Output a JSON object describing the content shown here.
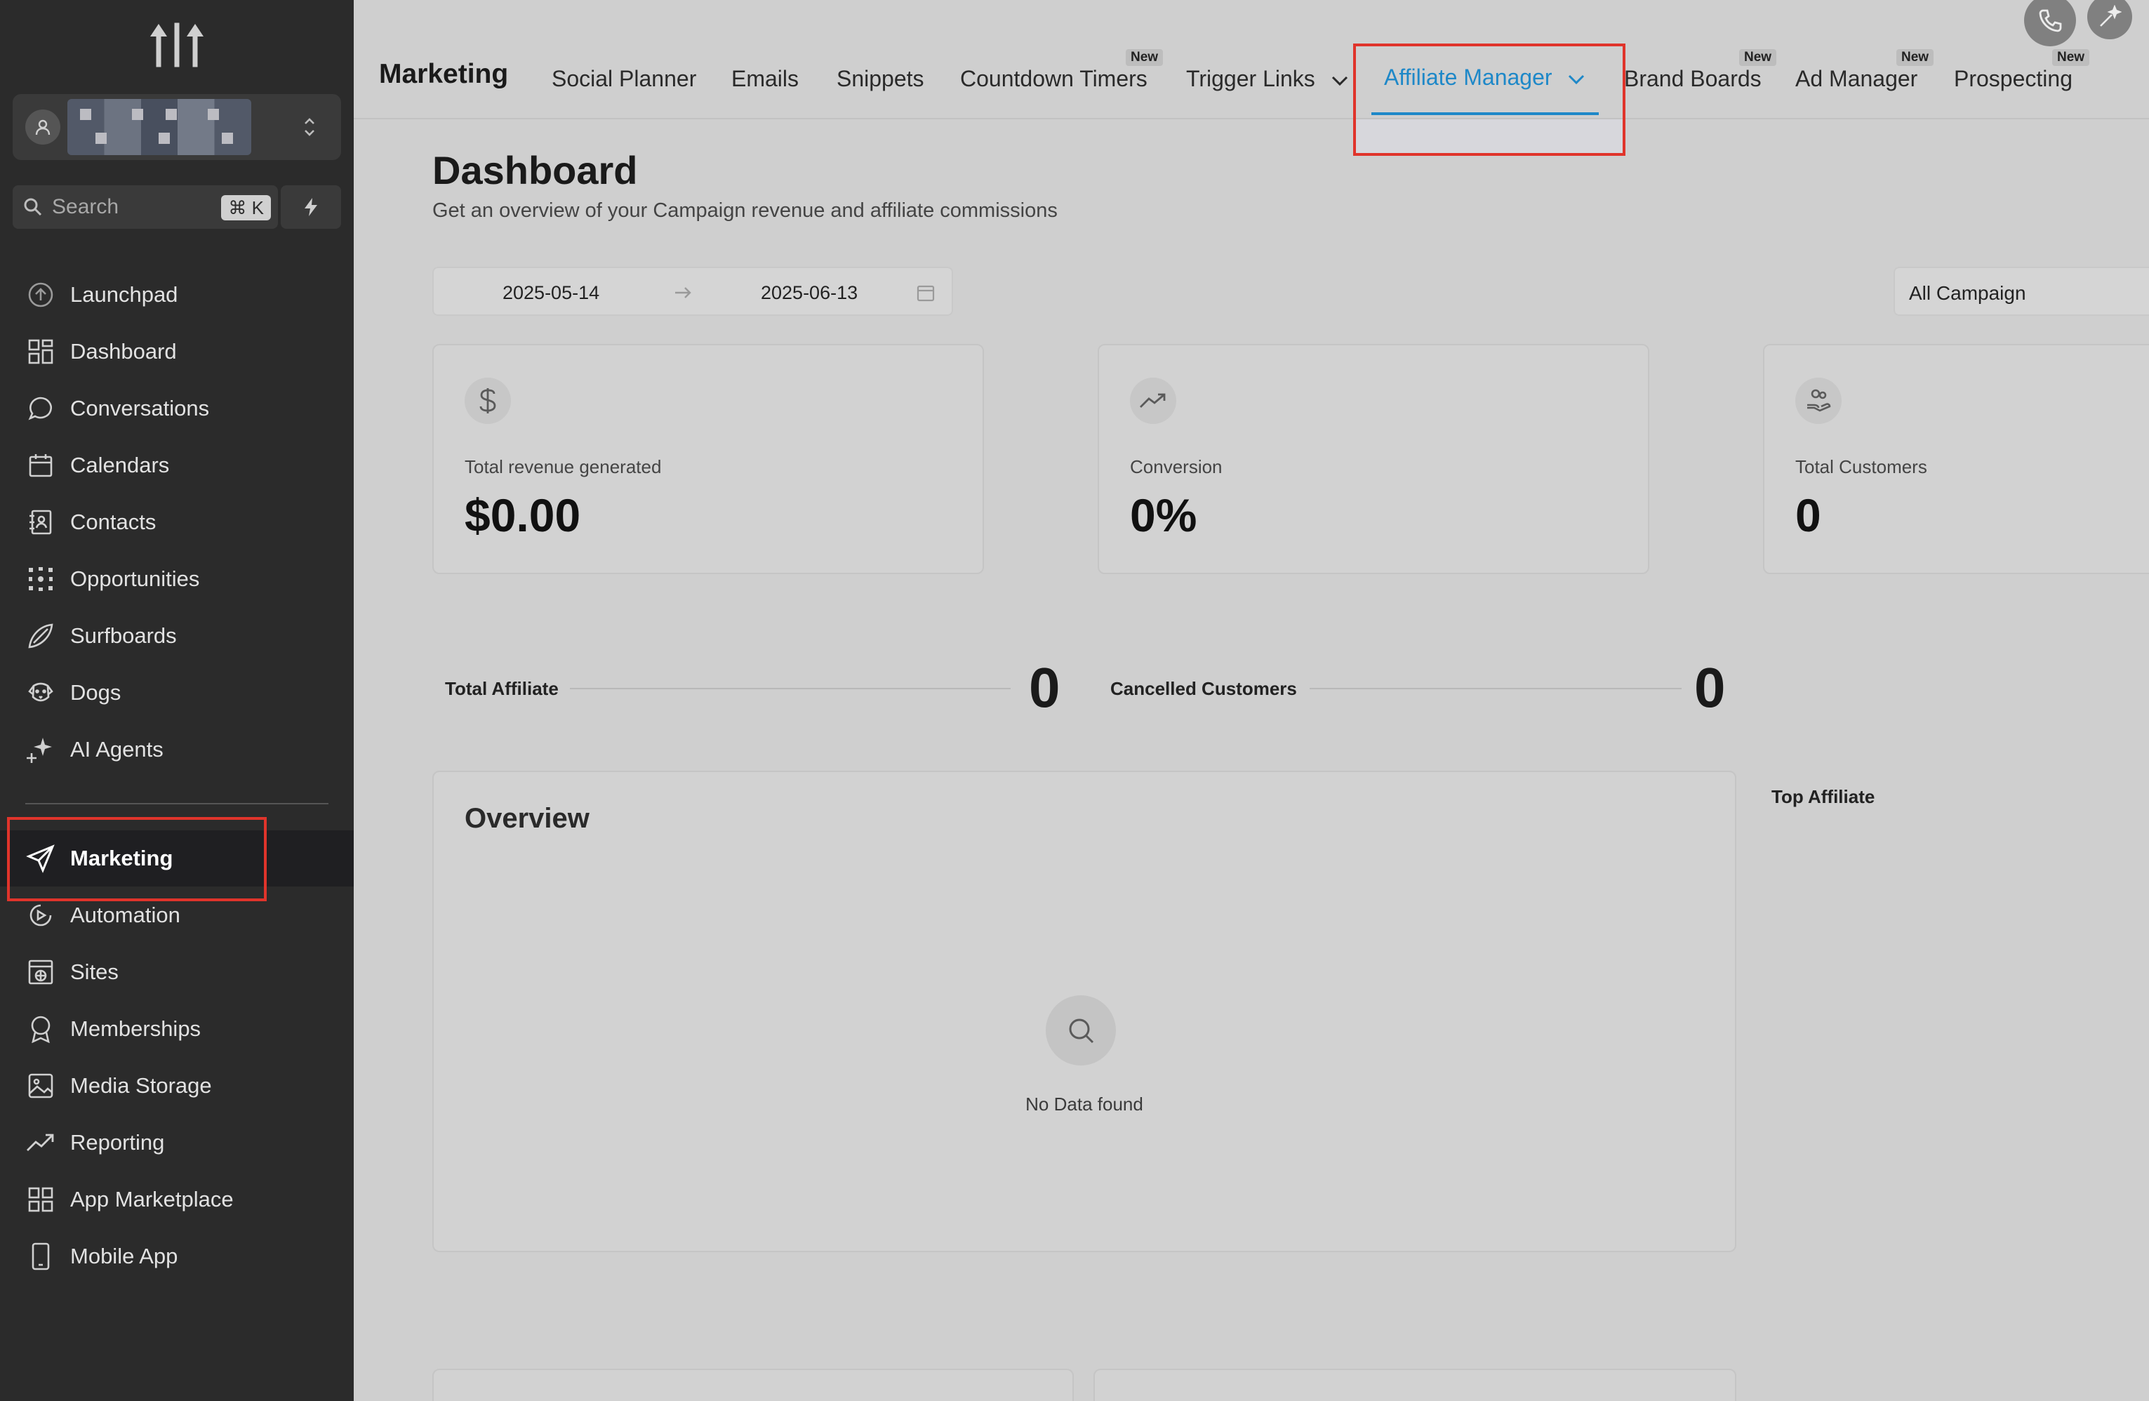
{
  "sidebar": {
    "search": {
      "placeholder": "Search",
      "shortcut": "⌘ K"
    },
    "items": [
      {
        "label": "Launchpad",
        "icon": "launchpad-icon"
      },
      {
        "label": "Dashboard",
        "icon": "grid-icon"
      },
      {
        "label": "Conversations",
        "icon": "chat-icon"
      },
      {
        "label": "Calendars",
        "icon": "calendar-icon"
      },
      {
        "label": "Contacts",
        "icon": "contacts-icon"
      },
      {
        "label": "Opportunities",
        "icon": "opportunities-icon"
      },
      {
        "label": "Surfboards",
        "icon": "surfboard-icon"
      },
      {
        "label": "Dogs",
        "icon": "dog-icon"
      },
      {
        "label": "AI Agents",
        "icon": "sparkle-icon"
      }
    ],
    "items_lower": [
      {
        "label": "Marketing",
        "icon": "send-icon",
        "active": true
      },
      {
        "label": "Automation",
        "icon": "automation-icon"
      },
      {
        "label": "Sites",
        "icon": "sites-icon"
      },
      {
        "label": "Memberships",
        "icon": "badge-icon"
      },
      {
        "label": "Media Storage",
        "icon": "image-icon"
      },
      {
        "label": "Reporting",
        "icon": "trend-icon"
      },
      {
        "label": "App Marketplace",
        "icon": "apps-icon"
      },
      {
        "label": "Mobile App",
        "icon": "phone-icon"
      }
    ]
  },
  "topbar": {
    "title": "Marketing",
    "tabs": [
      {
        "label": "Social Planner"
      },
      {
        "label": "Emails"
      },
      {
        "label": "Snippets"
      },
      {
        "label": "Countdown Timers",
        "badge": "New"
      },
      {
        "label": "Trigger Links"
      },
      {
        "label": "Affiliate Manager",
        "active": true
      },
      {
        "label": "Brand Boards",
        "badge": "New"
      },
      {
        "label": "Ad Manager",
        "badge": "New"
      },
      {
        "label": "Prospecting",
        "badge": "New"
      }
    ]
  },
  "page": {
    "title": "Dashboard",
    "subtitle": "Get an overview of your Campaign revenue and affiliate commissions",
    "date_start": "2025-05-14",
    "date_end": "2025-06-13",
    "campaign_filter": "All Campaign"
  },
  "stats": [
    {
      "label": "Total revenue generated",
      "value": "$0.00",
      "icon": "dollar-icon"
    },
    {
      "label": "Conversion",
      "value": "0%",
      "icon": "trend-up-icon"
    },
    {
      "label": "Total Customers",
      "value": "0",
      "icon": "customers-icon"
    }
  ],
  "metrics": [
    {
      "label": "Total Affiliate",
      "value": "0"
    },
    {
      "label": "Cancelled Customers",
      "value": "0"
    }
  ],
  "overview": {
    "title": "Overview",
    "empty_text": "No Data found"
  },
  "top_affiliate": {
    "title": "Top Affiliate"
  },
  "colors": {
    "accent": "#1e88c8",
    "highlight": "#e0342b",
    "sidebar_bg": "#2b2b2b"
  }
}
